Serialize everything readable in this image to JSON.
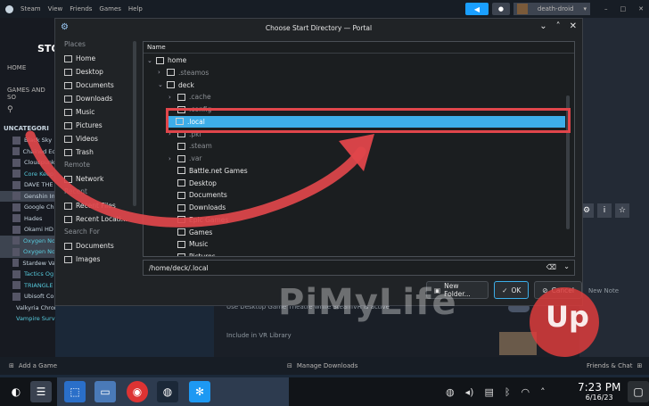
{
  "steam": {
    "menu": [
      "Steam",
      "View",
      "Friends",
      "Games",
      "Help"
    ],
    "username": "death-droid",
    "store_label": "STO",
    "home_label": "HOME",
    "games_label": "GAMES AND SO",
    "category": "UNCATEGORI",
    "games": [
      "Black Sky",
      "Chained Ec",
      "Cloudpunk",
      "Core Keep",
      "DAVE THE",
      "Genshin In",
      "Google Ch",
      "Hades",
      "Okami HD",
      "Oxygen No",
      "Oxygen No",
      "Stardew Va",
      "Tactics Og",
      "TRIANGLE",
      "Ubisoft Co",
      "Valkyria Chronicles 4 Complet",
      "Vampire Survivors - Update Q"
    ],
    "bg_text1": "Use Desktop Game Theatre while SteamVR is active",
    "bg_text2": "Include in VR Library",
    "new_note": "New Note",
    "bottom": {
      "add_game": "Add a Game",
      "manage_downloads": "Manage Downloads",
      "friends_chat": "Friends & Chat"
    }
  },
  "dialog": {
    "title": "Choose Start Directory — Portal",
    "places_header": "Places",
    "places": [
      "Home",
      "Desktop",
      "Documents",
      "Downloads",
      "Music",
      "Pictures",
      "Videos",
      "Trash"
    ],
    "remote_header": "Remote",
    "remote": [
      "Network"
    ],
    "recent_header": "Recent",
    "recent": [
      "Recent Files",
      "Recent Locati..."
    ],
    "search_header": "Search For",
    "search": [
      "Documents",
      "Images"
    ],
    "column_header": "Name",
    "tree": [
      {
        "label": "home",
        "depth": 0,
        "exp": "open",
        "dim": false
      },
      {
        "label": ".steamos",
        "depth": 1,
        "exp": "closed",
        "dim": true
      },
      {
        "label": "deck",
        "depth": 1,
        "exp": "open",
        "dim": false
      },
      {
        "label": ".cache",
        "depth": 2,
        "exp": "closed",
        "dim": true
      },
      {
        "label": ".config",
        "depth": 2,
        "exp": "closed",
        "dim": true
      },
      {
        "label": ".local",
        "depth": 2,
        "exp": "closed",
        "dim": false,
        "selected": true
      },
      {
        "label": ".pki",
        "depth": 2,
        "exp": "closed",
        "dim": true
      },
      {
        "label": ".steam",
        "depth": 2,
        "exp": "",
        "dim": true
      },
      {
        "label": ".var",
        "depth": 2,
        "exp": "closed",
        "dim": true
      },
      {
        "label": "Battle.net Games",
        "depth": 2,
        "exp": "",
        "dim": false
      },
      {
        "label": "Desktop",
        "depth": 2,
        "exp": "",
        "dim": false
      },
      {
        "label": "Documents",
        "depth": 2,
        "exp": "",
        "dim": false
      },
      {
        "label": "Downloads",
        "depth": 2,
        "exp": "",
        "dim": false
      },
      {
        "label": "Epic Games",
        "depth": 2,
        "exp": "",
        "dim": false
      },
      {
        "label": "Games",
        "depth": 2,
        "exp": "",
        "dim": false
      },
      {
        "label": "Music",
        "depth": 2,
        "exp": "",
        "dim": false
      },
      {
        "label": "Pictures",
        "depth": 2,
        "exp": "",
        "dim": false
      }
    ],
    "path_value": "/home/deck/.local",
    "new_folder": "New Folder...",
    "ok": "OK",
    "cancel": "Cancel"
  },
  "taskbar": {
    "time": "7:23 PM",
    "date": "6/16/23"
  },
  "watermark": {
    "text": "PiMyLife",
    "up": "Up"
  },
  "colors": {
    "accent": "#3daee9",
    "highlight": "#e0464b",
    "steam_blue": "#1a9fff"
  }
}
